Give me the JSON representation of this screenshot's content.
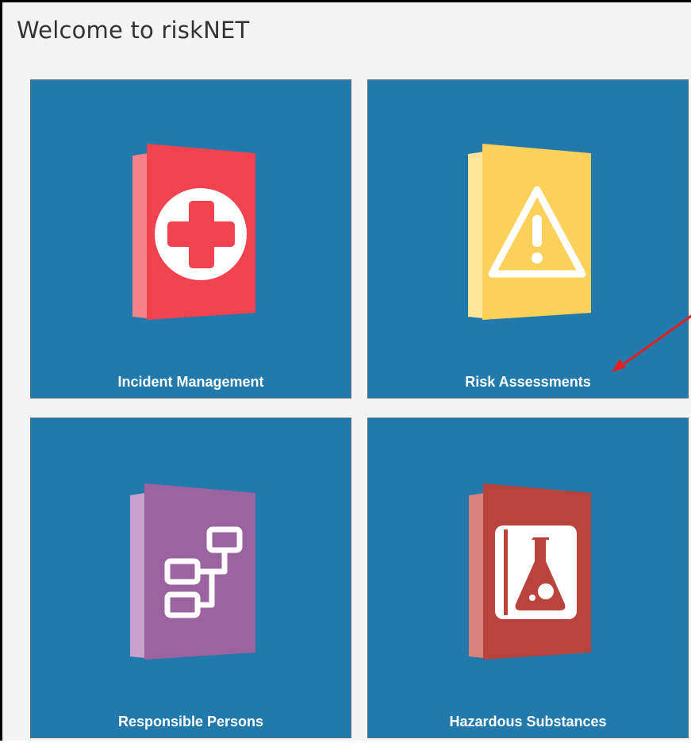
{
  "header": {
    "title": "Welcome to riskNET"
  },
  "tiles": [
    {
      "label": "Incident Management",
      "icon": "first-aid-book-icon",
      "color": "#f0434f"
    },
    {
      "label": "Risk Assessments",
      "icon": "warning-book-icon",
      "color": "#fcd15a"
    },
    {
      "label": "Responsible Persons",
      "icon": "org-chart-book-icon",
      "color": "#9b64a1"
    },
    {
      "label": "Hazardous Substances",
      "icon": "flask-book-icon",
      "color": "#b9443e"
    }
  ],
  "colors": {
    "tile_bg": "#2279ac",
    "page_bg": "#f4f4f4",
    "annotation_arrow": "#e02020"
  }
}
